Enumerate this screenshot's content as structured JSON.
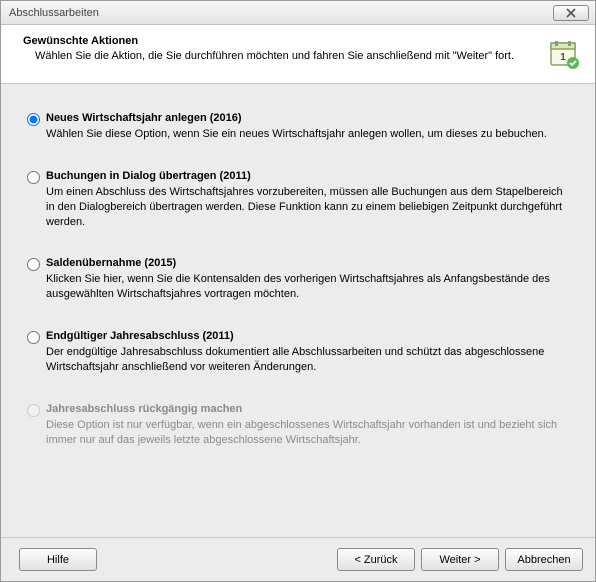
{
  "window": {
    "title": "Abschlussarbeiten"
  },
  "header": {
    "title": "Gewünschte Aktionen",
    "subtitle": "Wählen Sie die Aktion, die Sie durchführen möchten und fahren Sie anschließend mit \"Weiter\" fort."
  },
  "options": [
    {
      "title": "Neues Wirtschaftsjahr anlegen (2016)",
      "desc": "Wählen Sie diese Option, wenn Sie ein neues Wirtschaftsjahr anlegen wollen, um dieses zu bebuchen.",
      "selected": true,
      "enabled": true
    },
    {
      "title": "Buchungen in Dialog übertragen (2011)",
      "desc": "Um einen Abschluss des Wirtschaftsjahres vorzubereiten, müssen alle Buchungen aus dem Stapelbereich in den Dialogbereich übertragen werden. Diese Funktion kann zu einem beliebigen Zeitpunkt durchgeführt werden.",
      "selected": false,
      "enabled": true
    },
    {
      "title": "Saldenübernahme (2015)",
      "desc": "Klicken Sie hier, wenn Sie die Kontensalden des vorherigen Wirtschaftsjahres als Anfangsbestände des ausgewählten Wirtschaftsjahres vortragen möchten.",
      "selected": false,
      "enabled": true
    },
    {
      "title": "Endgültiger Jahresabschluss (2011)",
      "desc": "Der endgültige Jahresabschluss dokumentiert alle Abschlussarbeiten und schützt das abgeschlossene Wirtschaftsjahr anschließend vor weiteren Änderungen.",
      "selected": false,
      "enabled": true
    },
    {
      "title": "Jahresabschluss rückgängig machen",
      "desc": "Diese Option ist nur verfügbar, wenn ein abgeschlossenes Wirtschaftsjahr vorhanden ist und bezieht sich immer nur auf das jeweils letzte abgeschlossene Wirtschaftsjahr.",
      "selected": false,
      "enabled": false
    }
  ],
  "buttons": {
    "help": "Hilfe",
    "back": "< Zurück",
    "next": "Weiter >",
    "cancel": "Abbrechen"
  }
}
